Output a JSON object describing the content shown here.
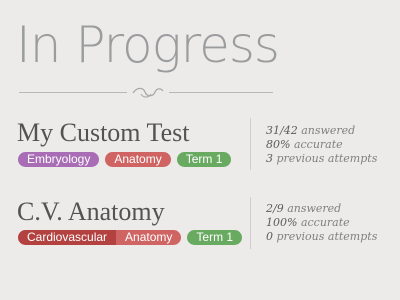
{
  "header": {
    "title": "In Progress"
  },
  "tests": [
    {
      "name": "My Custom Test",
      "tags": [
        "Embryology",
        "Anatomy",
        "Term 1"
      ],
      "stats": {
        "answered_value": "31/42",
        "answered_label": "answered",
        "accuracy_value": "80%",
        "accuracy_label": "accurate",
        "attempts_value": "3",
        "attempts_label": "previous attempts"
      }
    },
    {
      "name": "C.V. Anatomy",
      "tags": [
        "Cardiovascular",
        "Anatomy",
        "Term 1"
      ],
      "stats": {
        "answered_value": "2/9",
        "answered_label": "answered",
        "accuracy_value": "100%",
        "accuracy_label": "accurate",
        "attempts_value": "0",
        "attempts_label": "previous attempts"
      }
    }
  ],
  "colors": {
    "background": "#ecebea",
    "embryology_tag": "#a86db5",
    "anatomy_tag": "#cf6463",
    "cardiovascular_tag": "#b2413f",
    "term_tag": "#69aa61"
  },
  "icons": {
    "divider_ornament": "flourish-icon"
  }
}
